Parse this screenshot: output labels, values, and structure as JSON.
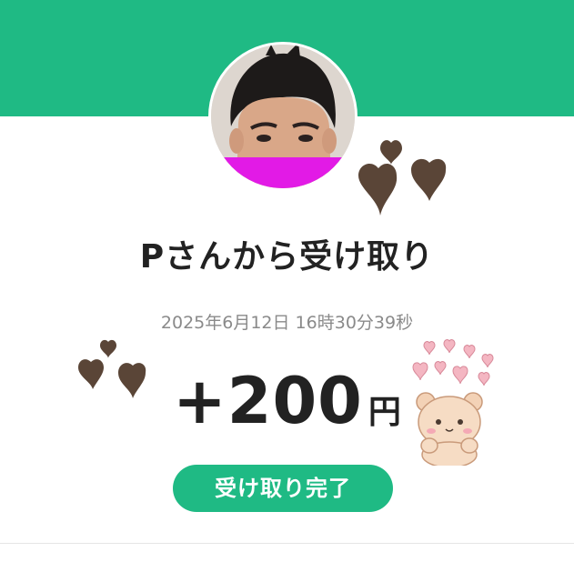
{
  "transaction": {
    "title": "Pさんから受け取り",
    "datetime": "2025年6月12日 16時30分39秒",
    "amount": "+200",
    "currency_unit": "円",
    "status": "受け取り完了"
  },
  "theme": {
    "accent": "#1fba84",
    "text_primary": "#222222",
    "text_secondary": "#8a8a8a",
    "heart_dark": "#5a4537",
    "heart_light": "#f4b6c2",
    "avatar_censor_bar": "#e21ae6"
  },
  "decorations": [
    "heart-sticker",
    "bear-sticker"
  ]
}
